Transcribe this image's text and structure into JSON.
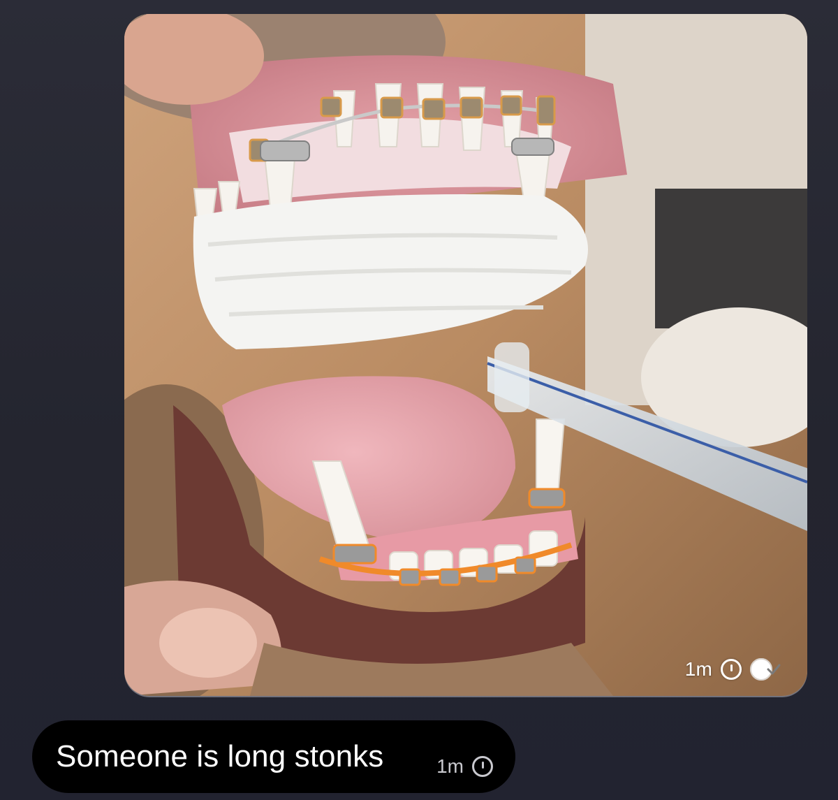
{
  "colors": {
    "background": "#24252f",
    "bubble": "#000000",
    "text": "#ffffff",
    "meta_text": "#c9c9cf"
  },
  "messages": [
    {
      "type": "image",
      "image": "dog-mouth-with-braces-photo",
      "time": "1m",
      "status_icons": [
        "clock-icon",
        "read-receipt-icon"
      ]
    },
    {
      "type": "text",
      "text": "Someone is long stonks",
      "time": "1m",
      "status_icons": [
        "clock-icon"
      ]
    }
  ]
}
